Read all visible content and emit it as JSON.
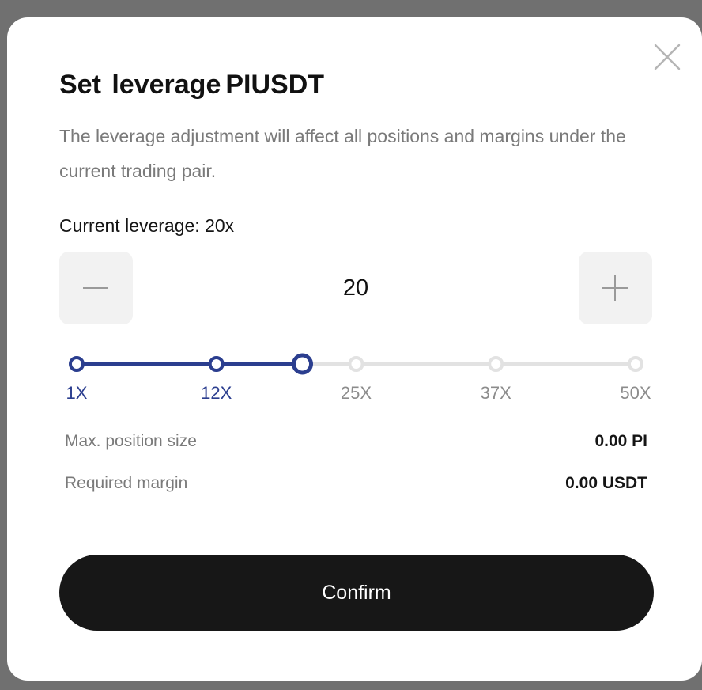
{
  "modal": {
    "title": "Set leverage",
    "pair": "PIUSDT",
    "description": "The leverage adjustment will affect all positions and margins under the current trading pair.",
    "current_leverage": "Current leverage: 20x",
    "close_icon": "close-icon"
  },
  "stepper": {
    "value": "20",
    "minus_icon": "minus-icon",
    "plus_icon": "plus-icon"
  },
  "slider": {
    "min": 1,
    "max": 50,
    "current": 20,
    "ticks": [
      {
        "label": "1X",
        "value": 1
      },
      {
        "label": "12X",
        "value": 12
      },
      {
        "label": "25X",
        "value": 25
      },
      {
        "label": "37X",
        "value": 37
      },
      {
        "label": "50X",
        "value": 50
      }
    ]
  },
  "info": {
    "max_position_label": "Max. position size",
    "max_position_value": "0.00 PI",
    "required_margin_label": "Required margin",
    "required_margin_value": "0.00 USDT"
  },
  "confirm_label": "Confirm",
  "colors": {
    "accent": "#2b3e8f",
    "track_inactive": "#e2e2e2",
    "button_dark": "#171717"
  }
}
